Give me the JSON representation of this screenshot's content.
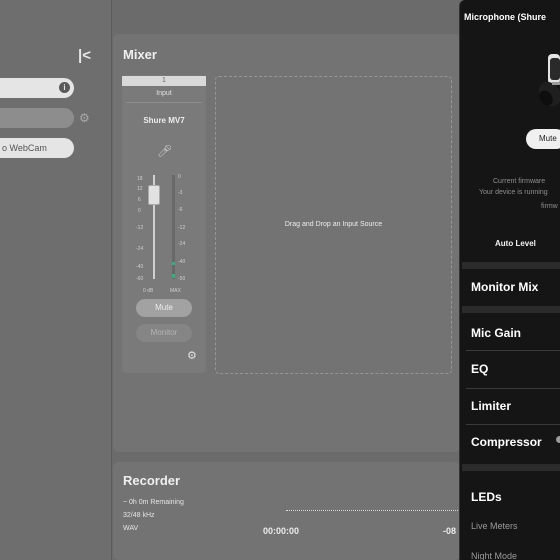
{
  "sidebar": {
    "collapse_icon": "collapse-left-icon",
    "info_icon": "info-icon",
    "settings_icon": "gear-icon",
    "webcam_item": "o WebCam"
  },
  "mixer": {
    "title": "Mixer",
    "channel": {
      "number": "1",
      "type_label": "Input",
      "device_name": "Shure MV7",
      "icon": "microphone-icon",
      "fader_scale": [
        "18",
        "12",
        "6",
        "0",
        "-12",
        "-24",
        "-40",
        "-60"
      ],
      "meter_scale": [
        "0",
        "-3",
        "-6",
        "-12",
        "-24",
        "-40",
        "-50"
      ],
      "footer_left": "0 dB",
      "footer_right": "MAX",
      "mute_label": "Mute",
      "monitor_label": "Monitor",
      "settings_icon": "gear-icon"
    },
    "dropzone_text": "Drag and Drop an Input Source"
  },
  "recorder": {
    "title": "Recorder",
    "remaining": "~ 0h 0m Remaining",
    "sample_rate": "32/48 kHz",
    "format": "WAV",
    "elapsed": "00:00:00",
    "level_partial": "-08"
  },
  "panel": {
    "title": "Microphone (Shure",
    "mute_label": "Mute",
    "firmware_line1": "Current firmware",
    "firmware_line2": "Your device is running",
    "firmware_line3": "firmw",
    "auto_level": "Auto Level",
    "items": [
      "Monitor Mix",
      "Mic Gain",
      "EQ",
      "Limiter",
      "Compressor",
      "LEDs"
    ],
    "sub_items": [
      "Live Meters",
      "Night Mode"
    ]
  },
  "colors": {
    "meter_green": "#2fb27b",
    "panel_bg": "#151515"
  }
}
